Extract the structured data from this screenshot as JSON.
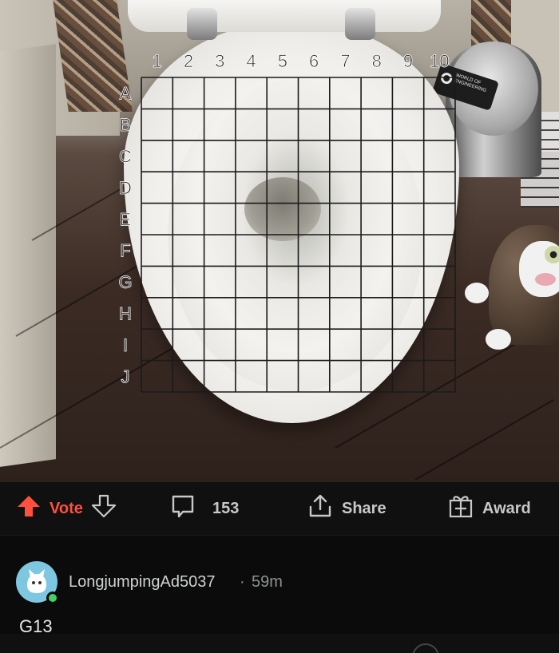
{
  "grid": {
    "columns": [
      "1",
      "2",
      "3",
      "4",
      "5",
      "6",
      "7",
      "8",
      "9",
      "10"
    ],
    "rows": [
      "A",
      "B",
      "C",
      "D",
      "E",
      "F",
      "G",
      "H",
      "I",
      "J"
    ]
  },
  "bin_badge": {
    "line1": "WORLD OF",
    "line2": "ENGINEERING"
  },
  "actions": {
    "vote_label": "Vote",
    "comment_count": "153",
    "share_label": "Share",
    "award_label": "Award"
  },
  "comment": {
    "username": "LongjumpingAd5037",
    "separator": "·",
    "time": "59m",
    "body": "G13"
  },
  "colors": {
    "upvote_accent": "#ff4f3f",
    "online_dot": "#46d160",
    "bar_background": "#101010"
  },
  "icons": [
    "upvote-arrow-icon",
    "downvote-arrow-icon",
    "comment-bubble-icon",
    "share-icon",
    "award-gift-icon"
  ]
}
